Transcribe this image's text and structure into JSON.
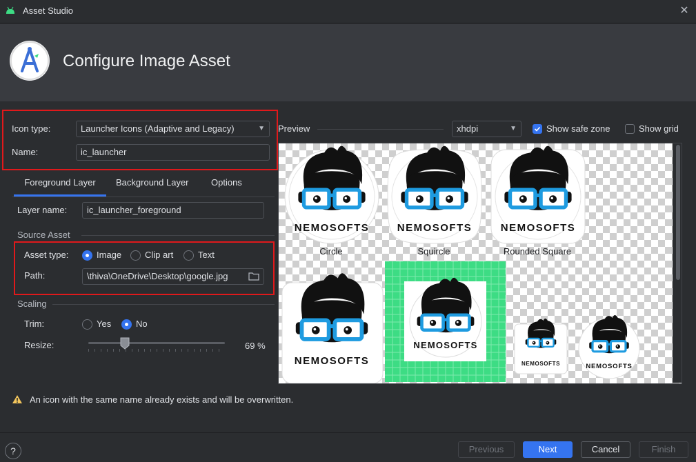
{
  "window": {
    "title": "Asset Studio",
    "close": "✕"
  },
  "header": {
    "title": "Configure Image Asset"
  },
  "config": {
    "icon_type_label": "Icon type:",
    "icon_type_value": "Launcher Icons (Adaptive and Legacy)",
    "name_label": "Name:",
    "name_value": "ic_launcher"
  },
  "tabs": [
    {
      "label": "Foreground Layer",
      "selected": true
    },
    {
      "label": "Background Layer",
      "selected": false
    },
    {
      "label": "Options",
      "selected": false
    }
  ],
  "layer": {
    "label": "Layer name:",
    "value": "ic_launcher_foreground"
  },
  "source": {
    "section": "Source Asset",
    "asset_type_label": "Asset type:",
    "asset_types": [
      "Image",
      "Clip art",
      "Text"
    ],
    "asset_type_selected": "Image",
    "path_label": "Path:",
    "path_value": "\\thiva\\OneDrive\\Desktop\\google.jpg"
  },
  "scaling": {
    "section": "Scaling",
    "trim_label": "Trim:",
    "trim_yes": "Yes",
    "trim_no": "No",
    "trim_selected": "No",
    "resize_label": "Resize:",
    "resize_value": 69,
    "resize_text": "69 %"
  },
  "preview": {
    "label": "Preview",
    "density": "xhdpi",
    "show_safe_zone_label": "Show safe zone",
    "show_safe_zone": true,
    "show_grid_label": "Show grid",
    "show_grid": false,
    "icon_text": "NEMOSOFTS",
    "captions": [
      "Circle",
      "Squircle",
      "Rounded Square"
    ]
  },
  "warning": {
    "text": "An icon with the same name already exists and will be overwritten."
  },
  "footer": {
    "help": "?",
    "previous": "Previous",
    "next": "Next",
    "cancel": "Cancel",
    "finish": "Finish"
  },
  "colors": {
    "accent": "#3574f0",
    "highlight": "#e0191b",
    "grid_green": "#3ddc84",
    "glasses_blue": "#1e9be0"
  }
}
